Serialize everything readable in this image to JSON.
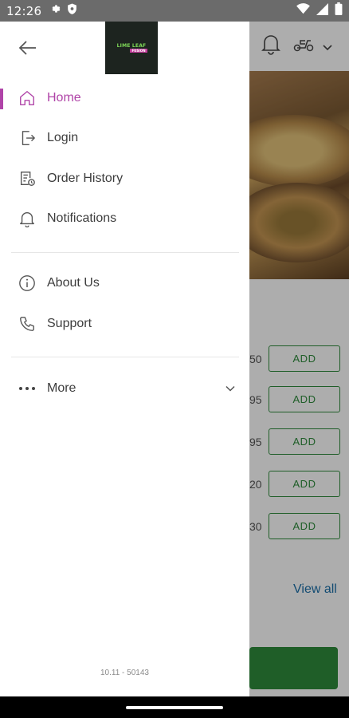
{
  "status_bar": {
    "time": "12:26",
    "left_icons": [
      "settings-icon",
      "shield-icon"
    ],
    "right_icons": [
      "wifi-icon",
      "signal-icon",
      "battery-icon"
    ]
  },
  "drawer": {
    "logo": {
      "line1": "LIME LEAF",
      "line2": "FUSION"
    },
    "menu": [
      {
        "label": "Home",
        "icon": "home-icon",
        "active": true
      },
      {
        "label": "Login",
        "icon": "login-icon"
      },
      {
        "label": "Order History",
        "icon": "order-history-icon"
      },
      {
        "label": "Notifications",
        "icon": "bell-icon"
      },
      {
        "label": "About Us",
        "icon": "info-icon"
      },
      {
        "label": "Support",
        "icon": "phone-icon"
      },
      {
        "label": "More",
        "icon": "more-dots-icon",
        "expandable": true
      }
    ],
    "version": "10.11 - 50143",
    "accent_color": "#b044a8"
  },
  "background": {
    "header_icons": [
      "bell-icon",
      "scooter-icon",
      "chevron-down-icon"
    ],
    "items": [
      {
        "price_fragment": "50",
        "button": "ADD"
      },
      {
        "price_fragment": "95",
        "button": "ADD"
      },
      {
        "price_fragment": "95",
        "button": "ADD"
      },
      {
        "price_fragment": "20",
        "button": "ADD"
      },
      {
        "price_fragment": "30",
        "button": "ADD"
      }
    ],
    "view_all": "View all",
    "accent_color": "#2e8b3c"
  }
}
